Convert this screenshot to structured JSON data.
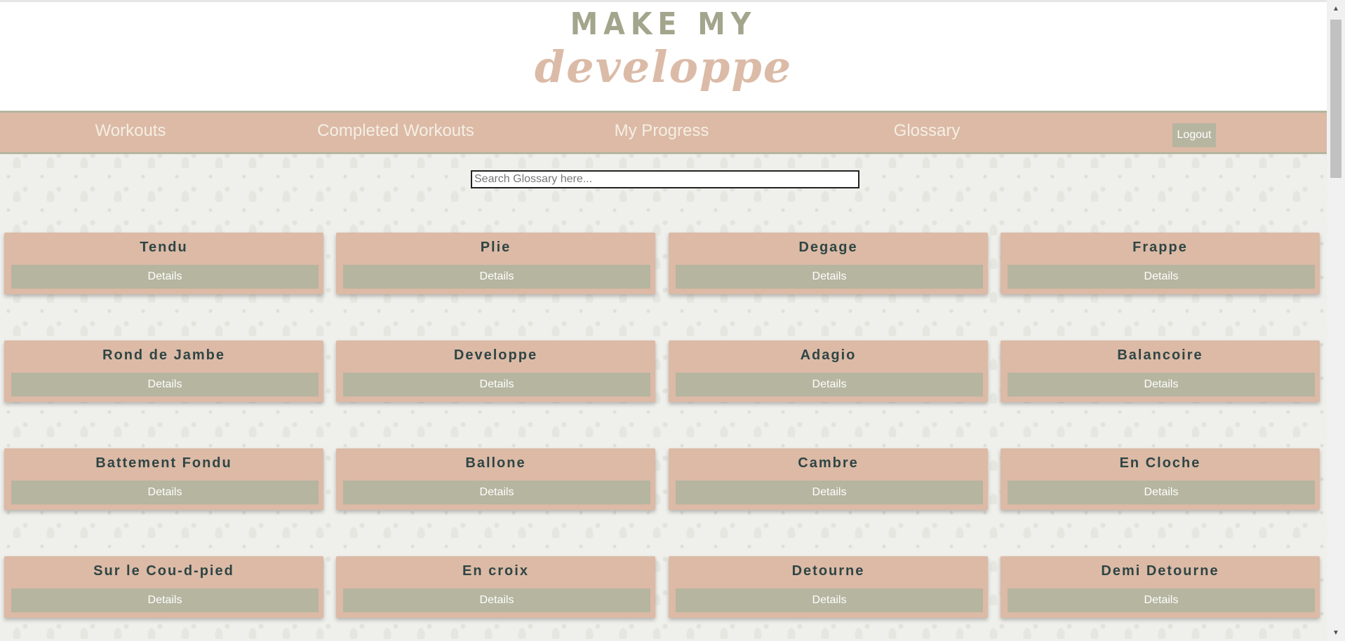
{
  "logo": {
    "top": "MAKE MY",
    "bottom": "developpe"
  },
  "nav": {
    "items": [
      "Workouts",
      "Completed Workouts",
      "My Progress",
      "Glossary"
    ],
    "logout": "Logout"
  },
  "search": {
    "placeholder": "Search Glossary here...",
    "value": ""
  },
  "cards": [
    {
      "title": "Tendu",
      "button": "Details"
    },
    {
      "title": "Plie",
      "button": "Details"
    },
    {
      "title": "Degage",
      "button": "Details"
    },
    {
      "title": "Frappe",
      "button": "Details"
    },
    {
      "title": "Rond de Jambe",
      "button": "Details"
    },
    {
      "title": "Developpe",
      "button": "Details"
    },
    {
      "title": "Adagio",
      "button": "Details"
    },
    {
      "title": "Balancoire",
      "button": "Details"
    },
    {
      "title": "Battement Fondu",
      "button": "Details"
    },
    {
      "title": "Ballone",
      "button": "Details"
    },
    {
      "title": "Cambre",
      "button": "Details"
    },
    {
      "title": "En Cloche",
      "button": "Details"
    },
    {
      "title": "Sur le Cou-d-pied",
      "button": "Details"
    },
    {
      "title": "En croix",
      "button": "Details"
    },
    {
      "title": "Detourne",
      "button": "Details"
    },
    {
      "title": "Demi Detourne",
      "button": "Details"
    }
  ],
  "colors": {
    "nav_bg": "#dcbaa6",
    "button_bg": "#b5b5a0",
    "title_text": "#2f4544",
    "logo_top": "#a3a58c",
    "logo_bottom": "#dbbba7"
  },
  "icons": {
    "scroll_up": "triangle-up-icon",
    "scroll_down": "triangle-down-icon"
  }
}
